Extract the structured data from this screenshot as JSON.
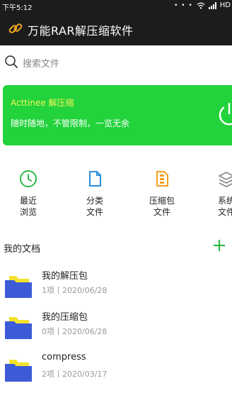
{
  "status_bar": {
    "time": "下午5:12",
    "network": "HD",
    "icons": [
      "notification-dots-icon",
      "wifi-icon",
      "signal-icon"
    ]
  },
  "app_bar": {
    "title": "万能RAR解压缩软件",
    "logo_icon": "link-icon"
  },
  "search": {
    "placeholder": "搜索文件",
    "icon": "search-icon"
  },
  "banner": {
    "title": "Acttinee 解压缩",
    "subtitle": "随时随地，不管限制，一览无余",
    "background": "#22d33c",
    "title_color": "#f1f55a",
    "icon": "power-cycle-icon"
  },
  "categories": [
    {
      "line1": "最近",
      "line2": "浏览",
      "icon": "clock-icon",
      "color": "#2db84a"
    },
    {
      "line1": "分类",
      "line2": "文件",
      "icon": "document-icon",
      "color": "#2b8fd8"
    },
    {
      "line1": "压缩包",
      "line2": "文件",
      "icon": "archive-icon",
      "color": "#f0a020"
    },
    {
      "line1": "系统",
      "line2": "文件",
      "icon": "layers-icon",
      "color": "#888888"
    }
  ],
  "my_docs": {
    "title": "我的文档",
    "add_icon": "plus-icon",
    "accent": "#22b33c",
    "items": [
      {
        "name": "我的解压包",
        "meta": "1项丨2020/06/28"
      },
      {
        "name": "我的压缩包",
        "meta": "0项丨2020/06/28"
      },
      {
        "name": "compress",
        "meta": "2项丨2020/03/17"
      }
    ]
  },
  "colors": {
    "bar": "#1c1c1c",
    "folder_blue": "#3d5bd6",
    "folder_yellow": "#f3e12b"
  }
}
